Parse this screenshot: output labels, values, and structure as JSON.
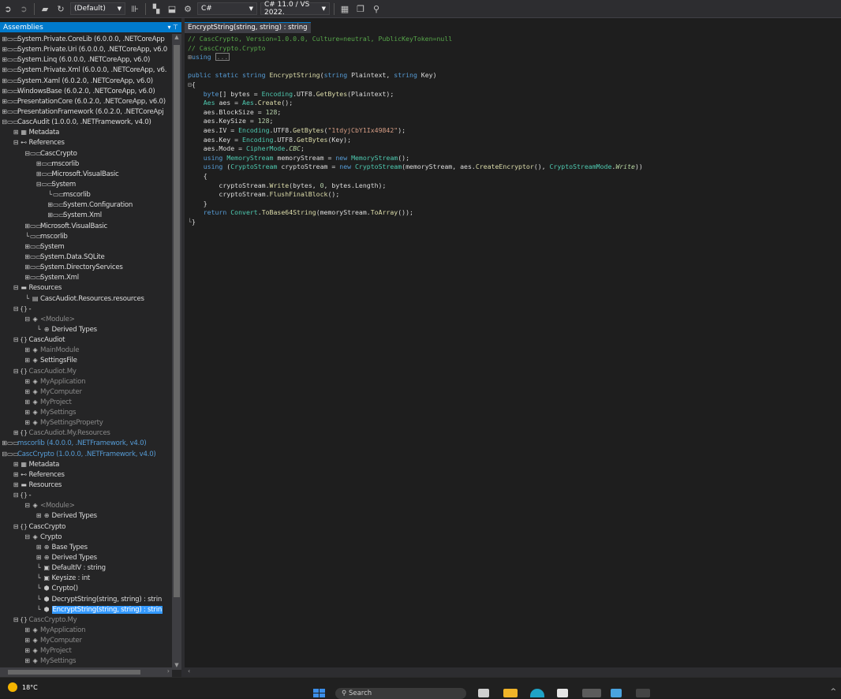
{
  "toolbar": {
    "language_filter": "(Default)",
    "language": "C#",
    "version": "C# 11.0 / VS 2022."
  },
  "assemblies_panel": {
    "title": "Assemblies",
    "rows": [
      {
        "exp": "⊞",
        "icon": "▭▭",
        "label": "System.Private.CoreLib (6.0.0.0, .NETCoreApp",
        "style": "",
        "indent": 0
      },
      {
        "exp": "⊞",
        "icon": "▭▭",
        "label": "System.Private.Uri (6.0.0.0, .NETCoreApp, v6.0",
        "style": "",
        "indent": 0
      },
      {
        "exp": "⊞",
        "icon": "▭▭",
        "label": "System.Linq (6.0.0.0, .NETCoreApp, v6.0)",
        "style": "",
        "indent": 0
      },
      {
        "exp": "⊞",
        "icon": "▭▭",
        "label": "System.Private.Xml (6.0.0.0, .NETCoreApp, v6.",
        "style": "",
        "indent": 0
      },
      {
        "exp": "⊞",
        "icon": "▭▭",
        "label": "System.Xaml (6.0.2.0, .NETCoreApp, v6.0)",
        "style": "",
        "indent": 0
      },
      {
        "exp": "⊞",
        "icon": "▭▭",
        "label": "WindowsBase (6.0.2.0, .NETCoreApp, v6.0)",
        "style": "",
        "indent": 0
      },
      {
        "exp": "⊞",
        "icon": "▭▭",
        "label": "PresentationCore (6.0.2.0, .NETCoreApp, v6.0)",
        "style": "",
        "indent": 0
      },
      {
        "exp": "⊞",
        "icon": "▭▭",
        "label": "PresentationFramework (6.0.2.0, .NETCoreApj",
        "style": "",
        "indent": 0
      },
      {
        "exp": "⊟",
        "icon": "▭▭",
        "label": "CascAudit (1.0.0.0, .NETFramework, v4.0)",
        "style": "",
        "indent": 0
      },
      {
        "exp": "⊞",
        "icon": "▦",
        "label": "Metadata",
        "style": "",
        "indent": 1
      },
      {
        "exp": "⊟",
        "icon": "⊷",
        "label": "References",
        "style": "",
        "indent": 1
      },
      {
        "exp": "⊟",
        "icon": "▭▭",
        "label": "CascCrypto",
        "style": "",
        "indent": 2
      },
      {
        "exp": "⊞",
        "icon": "▭▭",
        "label": "mscorlib",
        "style": "",
        "indent": 3
      },
      {
        "exp": "⊞",
        "icon": "▭▭",
        "label": "Microsoft.VisualBasic",
        "style": "",
        "indent": 3
      },
      {
        "exp": "⊟",
        "icon": "▭▭",
        "label": "System",
        "style": "",
        "indent": 3
      },
      {
        "exp": "",
        "icon": "▭▭",
        "label": "mscorlib",
        "style": "",
        "indent": 4
      },
      {
        "exp": "⊞",
        "icon": "▭▭",
        "label": "System.Configuration",
        "style": "",
        "indent": 4
      },
      {
        "exp": "⊞",
        "icon": "▭▭",
        "label": "System.Xml",
        "style": "",
        "indent": 4
      },
      {
        "exp": "⊞",
        "icon": "▭▭",
        "label": "Microsoft.VisualBasic",
        "style": "",
        "indent": 2
      },
      {
        "exp": "",
        "icon": "▭▭",
        "label": "mscorlib",
        "style": "",
        "indent": 2
      },
      {
        "exp": "⊞",
        "icon": "▭▭",
        "label": "System",
        "style": "",
        "indent": 2
      },
      {
        "exp": "⊞",
        "icon": "▭▭",
        "label": "System.Data.SQLite",
        "style": "",
        "indent": 2
      },
      {
        "exp": "⊞",
        "icon": "▭▭",
        "label": "System.DirectoryServices",
        "style": "",
        "indent": 2
      },
      {
        "exp": "⊞",
        "icon": "▭▭",
        "label": "System.Xml",
        "style": "",
        "indent": 2
      },
      {
        "exp": "⊟",
        "icon": "▬",
        "label": "Resources",
        "style": "",
        "indent": 1
      },
      {
        "exp": "",
        "icon": "▤",
        "label": "CascAudiot.Resources.resources",
        "style": "",
        "indent": 2
      },
      {
        "exp": "⊟",
        "icon": "{}",
        "label": "-",
        "style": "",
        "indent": 1
      },
      {
        "exp": "⊟",
        "icon": "◈",
        "label": "<Module>",
        "style": "dim",
        "indent": 2
      },
      {
        "exp": "",
        "icon": "⊕",
        "label": "Derived Types",
        "style": "",
        "indent": 3
      },
      {
        "exp": "⊟",
        "icon": "{}",
        "label": "CascAudiot",
        "style": "",
        "indent": 1
      },
      {
        "exp": "⊞",
        "icon": "◈",
        "label": "MainModule",
        "style": "dim",
        "indent": 2
      },
      {
        "exp": "⊞",
        "icon": "◈",
        "label": "SettingsFile",
        "style": "",
        "indent": 2
      },
      {
        "exp": "⊟",
        "icon": "{}",
        "label": "CascAudiot.My",
        "style": "dim",
        "indent": 1
      },
      {
        "exp": "⊞",
        "icon": "◈",
        "label": "MyApplication",
        "style": "dim",
        "indent": 2
      },
      {
        "exp": "⊞",
        "icon": "◈",
        "label": "MyComputer",
        "style": "dim",
        "indent": 2
      },
      {
        "exp": "⊞",
        "icon": "◈",
        "label": "MyProject",
        "style": "dim",
        "indent": 2
      },
      {
        "exp": "⊞",
        "icon": "◈",
        "label": "MySettings",
        "style": "dim",
        "indent": 2
      },
      {
        "exp": "⊞",
        "icon": "◈",
        "label": "MySettingsProperty",
        "style": "dim",
        "indent": 2
      },
      {
        "exp": "⊞",
        "icon": "{}",
        "label": "CascAudiot.My.Resources",
        "style": "dim",
        "indent": 1
      },
      {
        "exp": "⊞",
        "icon": "▭▭",
        "label": "mscorlib (4.0.0.0, .NETFramework, v4.0)",
        "style": "blue",
        "indent": 0
      },
      {
        "exp": "⊟",
        "icon": "▭▭",
        "label": "CascCrypto (1.0.0.0, .NETFramework, v4.0)",
        "style": "blue",
        "indent": 0
      },
      {
        "exp": "⊞",
        "icon": "▦",
        "label": "Metadata",
        "style": "",
        "indent": 1
      },
      {
        "exp": "⊞",
        "icon": "⊷",
        "label": "References",
        "style": "",
        "indent": 1
      },
      {
        "exp": "⊞",
        "icon": "▬",
        "label": "Resources",
        "style": "",
        "indent": 1
      },
      {
        "exp": "⊟",
        "icon": "{}",
        "label": "-",
        "style": "",
        "indent": 1
      },
      {
        "exp": "⊟",
        "icon": "◈",
        "label": "<Module>",
        "style": "dim",
        "indent": 2
      },
      {
        "exp": "⊞",
        "icon": "⊕",
        "label": "Derived Types",
        "style": "",
        "indent": 3
      },
      {
        "exp": "⊟",
        "icon": "{}",
        "label": "CascCrypto",
        "style": "",
        "indent": 1
      },
      {
        "exp": "⊟",
        "icon": "◈",
        "label": "Crypto",
        "style": "",
        "indent": 2
      },
      {
        "exp": "⊞",
        "icon": "⊕",
        "label": "Base Types",
        "style": "",
        "indent": 3
      },
      {
        "exp": "⊞",
        "icon": "⊕",
        "label": "Derived Types",
        "style": "",
        "indent": 3
      },
      {
        "exp": "",
        "icon": "▣",
        "label": "DefaultIV : string",
        "style": "",
        "indent": 3
      },
      {
        "exp": "",
        "icon": "▣",
        "label": "Keysize : int",
        "style": "",
        "indent": 3
      },
      {
        "exp": "",
        "icon": "⬢",
        "label": "Crypto()",
        "style": "",
        "indent": 3
      },
      {
        "exp": "",
        "icon": "⬢",
        "label": "DecryptString(string, string) : strin",
        "style": "",
        "indent": 3
      },
      {
        "exp": "",
        "icon": "⬢",
        "label": "EncryptString(string, string) : strin",
        "style": "selected",
        "indent": 3
      },
      {
        "exp": "⊟",
        "icon": "{}",
        "label": "CascCrypto.My",
        "style": "dim",
        "indent": 1
      },
      {
        "exp": "⊞",
        "icon": "◈",
        "label": "MyApplication",
        "style": "dim",
        "indent": 2
      },
      {
        "exp": "⊞",
        "icon": "◈",
        "label": "MyComputer",
        "style": "dim",
        "indent": 2
      },
      {
        "exp": "⊞",
        "icon": "◈",
        "label": "MyProject",
        "style": "dim",
        "indent": 2
      },
      {
        "exp": "⊞",
        "icon": "◈",
        "label": "MySettings",
        "style": "dim",
        "indent": 2
      }
    ]
  },
  "editor": {
    "tab_title": "EncryptString(string, string) : string",
    "code": {
      "comment1": "// CascCrypto, Version=1.0.0.0, Culture=neutral, PublicKeyToken=null",
      "comment2": "// CascCrypto.Crypto",
      "using_kw": "using",
      "using_collapsed": "...",
      "iv_string": "\"1tdyjCbY1Ix49842\""
    }
  },
  "taskbar": {
    "weather": "18°C",
    "search_placeholder": "Search"
  }
}
